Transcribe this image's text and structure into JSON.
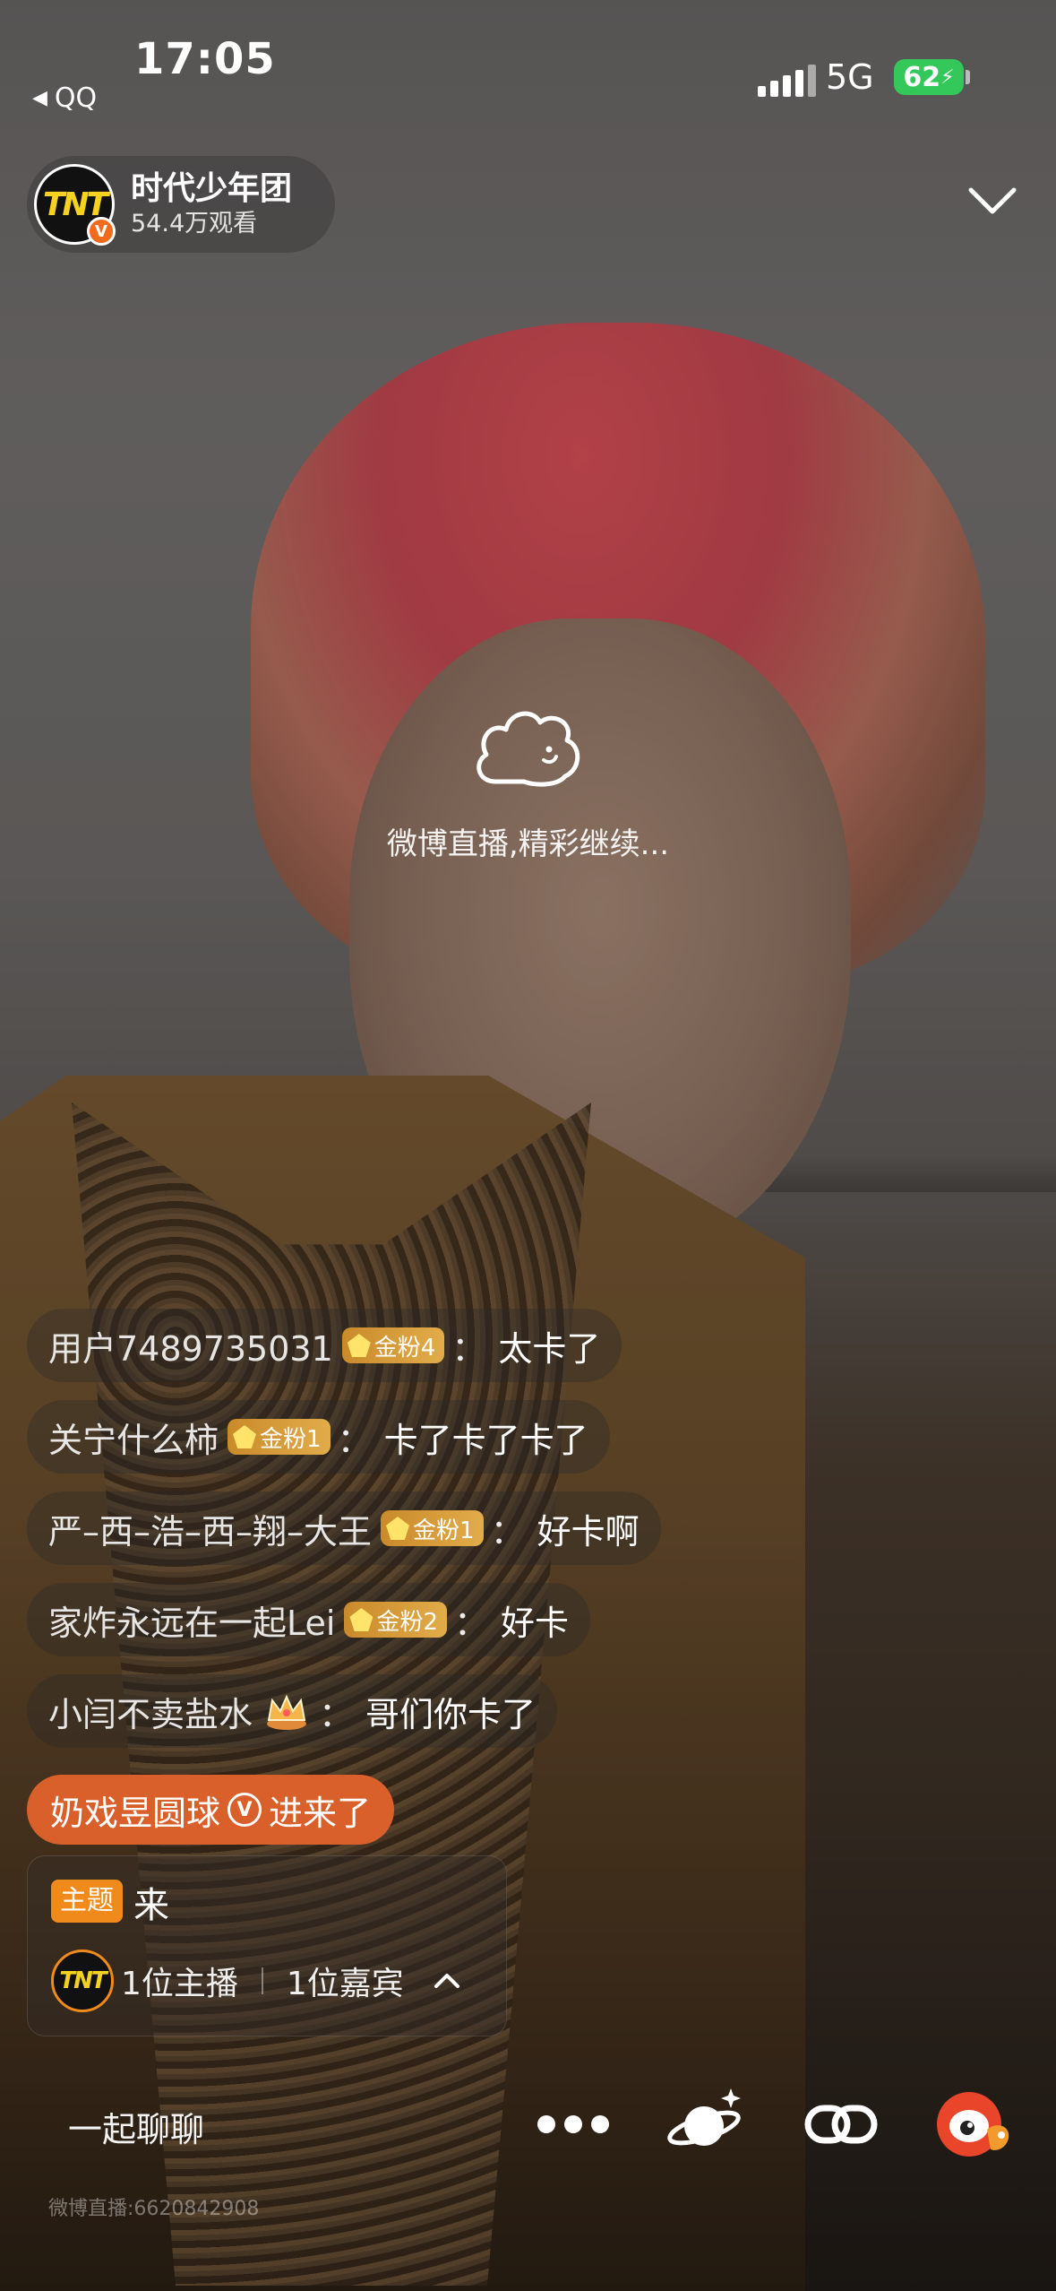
{
  "status_bar": {
    "time": "17:05",
    "back_app": "QQ",
    "network": "5G",
    "battery": "62"
  },
  "host": {
    "name": "时代少年团",
    "views": "54.4万观看",
    "avatar_logo": "TNT",
    "verified_badge": "V"
  },
  "center": {
    "message": "微博直播,精彩继续..."
  },
  "chat": [
    {
      "user": "用户7489735031",
      "badge": "金粉4",
      "message": "太卡了"
    },
    {
      "user": "关宁什么柿",
      "badge": "金粉1",
      "message": "卡了卡了卡了"
    },
    {
      "user": "严–西–浩–西–翔–大王",
      "badge": "金粉1",
      "message": "好卡啊"
    },
    {
      "user": "家炸永远在一起Lei",
      "badge": "金粉2",
      "message": "好卡"
    },
    {
      "user": "小闫不卖盐水",
      "badge": "",
      "message": "哥们你卡了"
    }
  ],
  "colon": "：",
  "entry_notice": {
    "user": "奶戏昱圆球",
    "badge": "V",
    "action": "进来了"
  },
  "topic": {
    "tag": "主题",
    "text": "来",
    "hosts": "1位主播",
    "guests": "1位嘉宾"
  },
  "bottom_bar": {
    "chat_together": "一起聊聊",
    "room_id": "微博直播:6620842908"
  },
  "colors": {
    "battery": "#34c759",
    "entry_pill": "#d9602a",
    "topic_tag": "#f08a1a",
    "fan_badge": "#d99a38"
  }
}
